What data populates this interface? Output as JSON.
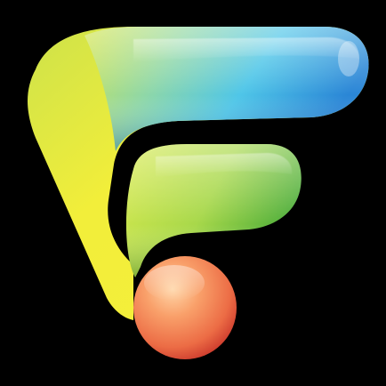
{
  "icon": {
    "name": "f-logo-icon",
    "colors": {
      "background": "#000000",
      "yellow": "#F2EE3A",
      "lime": "#B8E04E",
      "green": "#6EC045",
      "cyan": "#4FC6E8",
      "blue": "#2A86D6",
      "orange": "#F59A5A",
      "red": "#E2553E"
    }
  }
}
